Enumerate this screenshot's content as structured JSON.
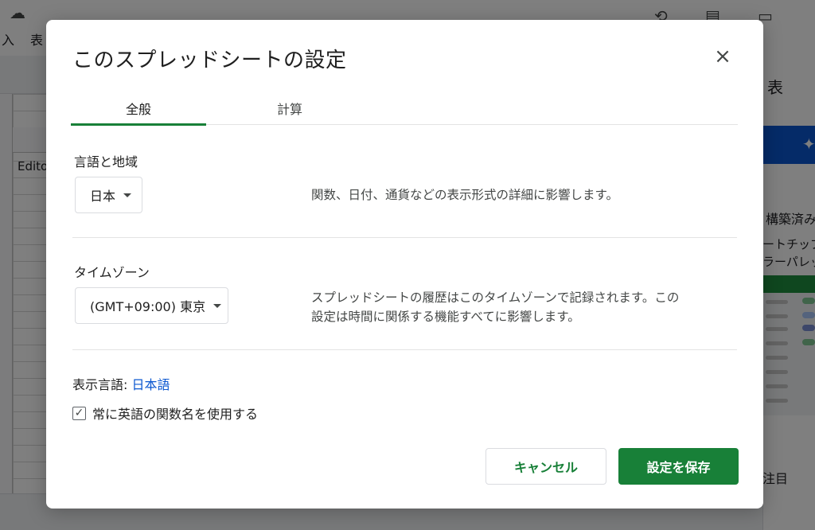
{
  "background": {
    "menu_partial_1": "入",
    "menu_partial_2": "表",
    "cell_text": "Edito",
    "panel_title_partial": "表",
    "panel_text_1": "構築済み",
    "panel_text_2": "ートチップ",
    "panel_text_3": "ラーパレッ",
    "panel_text_4": "注目"
  },
  "dialog": {
    "title": "このスプレッドシートの設定",
    "close_icon": "close-icon",
    "tabs": [
      {
        "label": "全般",
        "active": true
      },
      {
        "label": "計算",
        "active": false
      }
    ],
    "locale": {
      "label": "言語と地域",
      "value": "日本",
      "description": "関数、日付、通貨などの表示形式の詳細に影響します。"
    },
    "timezone": {
      "label": "タイムゾーン",
      "value": "(GMT+09:00) 東京",
      "description_line1": "スプレッドシートの履歴はこのタイムゾーンで記録されます。この",
      "description_line2": "設定は時間に関係する機能すべてに影響します。"
    },
    "display_language": {
      "prefix": "表示言語:",
      "link": "日本語"
    },
    "english_functions": {
      "label": "常に英語の関数名を使用する",
      "checked": true
    },
    "buttons": {
      "cancel": "キャンセル",
      "save": "設定を保存"
    }
  },
  "colors": {
    "accent_green": "#188038",
    "link_blue": "#0b57d0"
  }
}
